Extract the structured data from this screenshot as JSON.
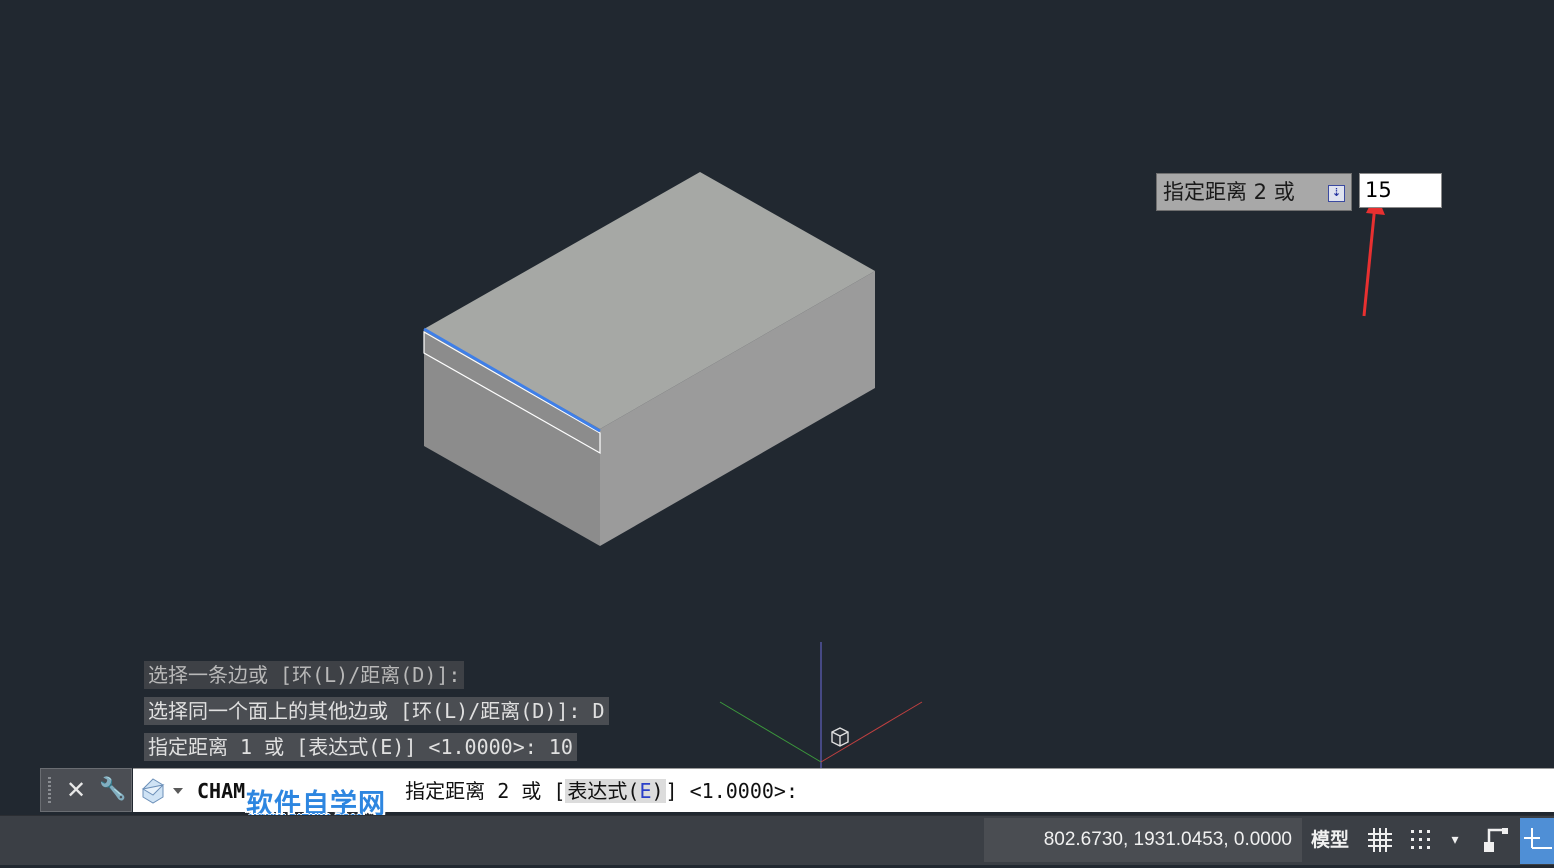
{
  "viewport": {
    "background": "#212830",
    "ucs_icon": "ucs-axes-icon",
    "box_face_colors": {
      "top": "#a6a8a5",
      "left": "#8c8c8c",
      "right": "#9b9b9b"
    },
    "highlight_edge_color": "#3f7fe8"
  },
  "dynamic_input": {
    "label": "指定距离 2 或",
    "dropdown_icon": "arrow-down-icon",
    "value": "15",
    "annotation_icon": "red-arrow-icon"
  },
  "command_history": [
    "选择一条边或 [环(L)/距离(D)]:",
    "选择同一个面上的其他边或 [环(L)/距离(D)]: D",
    "指定距离 1 或 [表达式(E)] <1.0000>: 10"
  ],
  "command_line": {
    "close_icon": "close-icon",
    "customize_icon": "wrench-icon",
    "recent_icon": "recent-commands-icon",
    "prefix": "CHAM",
    "prompt_before": "指定距离 2 或 [",
    "option_label_before": "表达式(",
    "option_key": "E",
    "option_label_after": ")",
    "prompt_after": "] <1.0000>:"
  },
  "watermark": {
    "text": "软件自学网",
    "url": "WWW.RJZXW.COM"
  },
  "status_bar": {
    "coordinates": "802.6730, 1931.0453, 0.0000",
    "model_label": "模型",
    "grid_icon": "grid-icon",
    "snap_icon": "snap-dots-icon",
    "snap_dropdown": "▾",
    "ortho_icon": "ortho-icon",
    "polar_icon": "polar-tracking-icon",
    "active_color": "#4f8fd6"
  }
}
